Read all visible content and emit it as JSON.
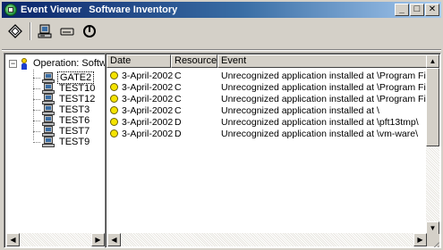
{
  "window": {
    "title_app": "Event Viewer",
    "title_doc": "Software Inventory",
    "minimize": "_",
    "maximize": "□",
    "close": "✕"
  },
  "toolbar": {
    "buttons": [
      {
        "icon": "properties-icon"
      },
      {
        "icon": "computer-icon"
      },
      {
        "icon": "drive-icon"
      },
      {
        "icon": "power-icon"
      }
    ]
  },
  "tree": {
    "root_label": "Operation: Softw",
    "root_expander": "−",
    "items": [
      {
        "label": "GATE2",
        "selected": true
      },
      {
        "label": "TEST10"
      },
      {
        "label": "TEST12"
      },
      {
        "label": "TEST3"
      },
      {
        "label": "TEST6"
      },
      {
        "label": "TEST7"
      },
      {
        "label": "TEST9"
      }
    ]
  },
  "list": {
    "columns": {
      "date": "Date",
      "resource": "Resource",
      "event": "Event"
    },
    "rows": [
      {
        "date": "3-April-2002",
        "resource": "C",
        "event": "Unrecognized application installed at \\Program Files\\Wind"
      },
      {
        "date": "3-April-2002",
        "resource": "C",
        "event": "Unrecognized application installed at \\Program Files\\NetM"
      },
      {
        "date": "3-April-2002",
        "resource": "C",
        "event": "Unrecognized application installed at \\Program Files\\Wind"
      },
      {
        "date": "3-April-2002",
        "resource": "C",
        "event": "Unrecognized application installed at \\"
      },
      {
        "date": "3-April-2002",
        "resource": "D",
        "event": "Unrecognized application installed at \\pft13tmp\\"
      },
      {
        "date": "3-April-2002",
        "resource": "D",
        "event": "Unrecognized application installed at \\vm-ware\\"
      }
    ]
  },
  "scroll": {
    "left": "◀",
    "right": "▶",
    "up": "▲",
    "down": "▼"
  },
  "colors": {
    "title_start": "#0a246a",
    "status_dot": "#f5e400",
    "chrome": "#d4d0c8"
  }
}
